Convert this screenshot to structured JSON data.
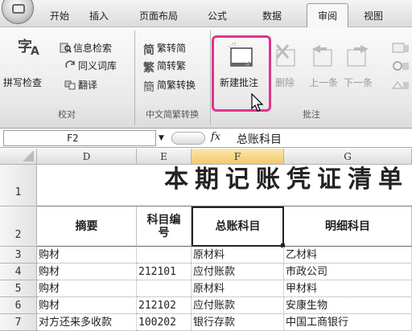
{
  "tabs": [
    {
      "label": "开始",
      "active": false
    },
    {
      "label": "插入",
      "active": false
    },
    {
      "label": "页面布局",
      "active": false
    },
    {
      "label": "公式",
      "active": false
    },
    {
      "label": "数据",
      "active": false
    },
    {
      "label": "审阅",
      "active": true
    },
    {
      "label": "视图",
      "active": false
    }
  ],
  "ribbon": {
    "proofing": {
      "spelling_label": "拼写检查",
      "research_label": "信息检索",
      "thesaurus_label": "同义词库",
      "translate_label": "翻译",
      "group_label": "校对"
    },
    "chinese_conversion": {
      "to_simplified_label": "繁转简",
      "to_traditional_label": "简转繁",
      "conversion_label": "简繁转换",
      "group_label": "中文简繁转换"
    },
    "comments": {
      "new_label": "新建批注",
      "delete_label": "删除",
      "prev_label": "上一条",
      "next_label": "下一条",
      "group_label": "批注"
    }
  },
  "formula_bar": {
    "cell_ref": "F2",
    "fx_label": "fx",
    "content": "总账科目"
  },
  "columns": [
    "D",
    "E",
    "F",
    "G"
  ],
  "sheet": {
    "title": "本期记账凭证清单",
    "headers": [
      "摘要",
      "科目编号",
      "总账科目",
      "明细科目"
    ],
    "rows": [
      {
        "num": "3",
        "desc": "购材",
        "code": "",
        "ledger": "原材料",
        "detail": "乙材料"
      },
      {
        "num": "4",
        "desc": "购材",
        "code": "212101",
        "ledger": "应付账款",
        "detail": "市政公司"
      },
      {
        "num": "5",
        "desc": "购材",
        "code": "",
        "ledger": "原材料",
        "detail": "甲材料"
      },
      {
        "num": "6",
        "desc": "购材",
        "code": "212102",
        "ledger": "应付账款",
        "detail": "安康生物"
      },
      {
        "num": "7",
        "desc": "对方还来多收款",
        "code": "100202",
        "ledger": "银行存款",
        "detail": "中国工商银行"
      }
    ],
    "row_labels": [
      "1",
      "2"
    ]
  },
  "colors": {
    "highlight": "#e0348c",
    "selected_header": "#f3c968"
  }
}
